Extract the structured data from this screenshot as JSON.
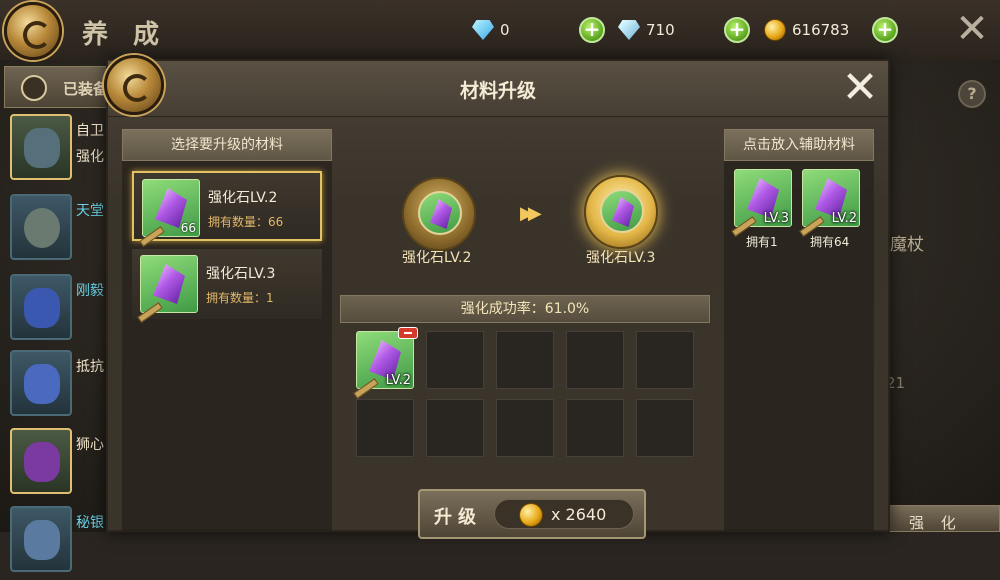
{
  "header": {
    "title": "养 成",
    "currencies": [
      {
        "icon": "diamond-icon",
        "value": "0"
      },
      {
        "icon": "bound-diamond-icon",
        "value": "710"
      },
      {
        "icon": "gold-coin-icon",
        "value": "616783"
      }
    ],
    "plus_label": "+",
    "close_label": "✕"
  },
  "left_tab": {
    "label": "已装备"
  },
  "side_items": [
    {
      "name": "自卫",
      "sub": "强化",
      "color": "white"
    },
    {
      "name": "天堂",
      "sub": "",
      "color": "cyan"
    },
    {
      "name": "刚毅",
      "sub": "",
      "color": "cyan"
    },
    {
      "name": "抵抗",
      "sub": "",
      "color": "white"
    },
    {
      "name": "狮心",
      "sub": "",
      "color": "white"
    },
    {
      "name": "秘银",
      "sub": "",
      "color": "cyan"
    }
  ],
  "background_right": {
    "help_label": "?",
    "item_name": "魔杖",
    "misc_value": "21",
    "enhance_button": "强 化"
  },
  "dialog": {
    "title": "材料升级",
    "close_label": "✕",
    "select_header": "选择要升级的材料",
    "materials": [
      {
        "name": "强化石LV.2",
        "own_text": "拥有数量：66",
        "count": "66",
        "selected": true
      },
      {
        "name": "强化石LV.3",
        "own_text": "拥有数量：1",
        "count": "",
        "selected": false
      }
    ],
    "from_label": "强化石LV.2",
    "to_label": "强化石LV.3",
    "arrow": "▶▶",
    "success_rate": "强化成功率：61.0%",
    "slots": [
      {
        "filled": true,
        "lv": "LV.2"
      },
      {
        "filled": false
      },
      {
        "filled": false
      },
      {
        "filled": false
      },
      {
        "filled": false
      },
      {
        "filled": false
      },
      {
        "filled": false
      },
      {
        "filled": false
      },
      {
        "filled": false
      },
      {
        "filled": false
      }
    ],
    "assist_header": "点击放入辅助材料",
    "assist_items": [
      {
        "lv": "LV.3",
        "own": "拥有1"
      },
      {
        "lv": "LV.2",
        "own": "拥有64"
      }
    ],
    "upgrade_label": "升级",
    "cost": "x 2640"
  },
  "colors": {
    "accent_gold": "#e2c263",
    "crystal_purple": "#b05ae6",
    "thumb_green": "#6fc062"
  }
}
